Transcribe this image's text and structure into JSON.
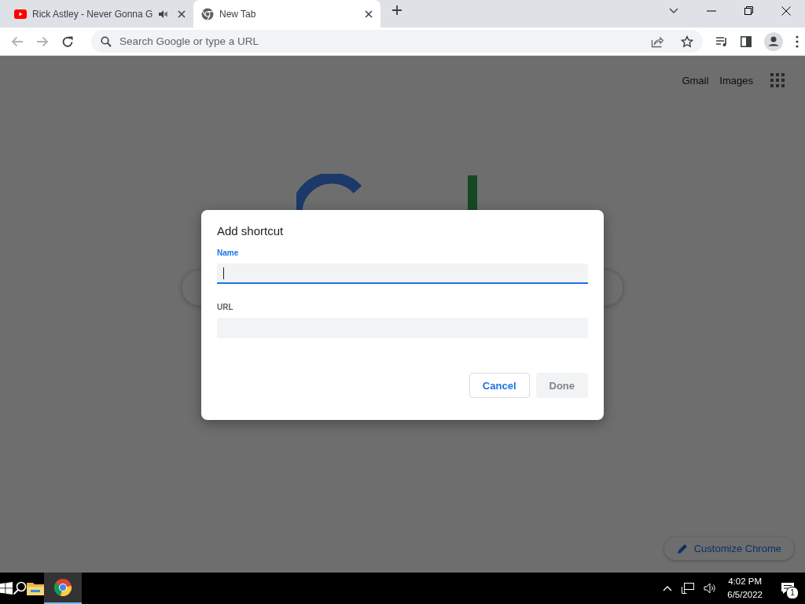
{
  "tabs": [
    {
      "title": "Rick Astley - Never Gonna G",
      "kind": "video",
      "audio": true,
      "selected": false
    },
    {
      "title": "New Tab",
      "kind": "browser",
      "audio": false,
      "selected": true
    }
  ],
  "omnibox": {
    "placeholder": "Search Google or type a URL"
  },
  "header_links": [
    "Gmail",
    "Images"
  ],
  "dialog": {
    "title": "Add shortcut",
    "fields": [
      {
        "label": "Name",
        "focused": true
      },
      {
        "label": "URL",
        "focused": false
      }
    ],
    "buttons": [
      {
        "label": "Cancel",
        "disabled": false
      },
      {
        "label": "Done",
        "disabled": true
      }
    ]
  },
  "customize_button": "Customize Chrome",
  "taskbar": {
    "time": "4:02 PM",
    "date": "6/5/2022",
    "notification_count": "1"
  }
}
